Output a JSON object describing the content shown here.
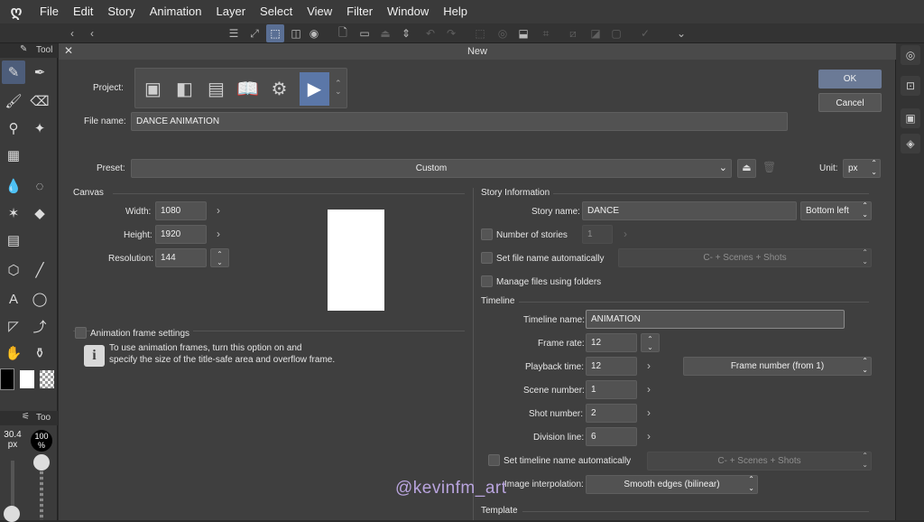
{
  "menubar": {
    "logo": "ღ",
    "items": [
      "File",
      "Edit",
      "Story",
      "Animation",
      "Layer",
      "Select",
      "View",
      "Filter",
      "Window",
      "Help"
    ]
  },
  "command_bar": {
    "icons": [
      "menu-icon",
      "resize-icon",
      "transform-icon",
      "color-profile-icon",
      "new-file-icon",
      "open-file-icon",
      "save-icon",
      "scroll-icon",
      "undo-icon",
      "redo-icon",
      "select-icon",
      "fill-icon",
      "clear-icon",
      "crop-icon",
      "deselect-icon",
      "invert-icon",
      "border-icon",
      "check-icon",
      "chevron-down-icon"
    ]
  },
  "left_panel": {
    "tool_header": "Tool",
    "sub_tool_header": "Too",
    "brush_size": "30.4",
    "brush_unit": "px",
    "opacity": "100",
    "opacity_unit": "%"
  },
  "dialog": {
    "title": "New",
    "project_label": "Project:",
    "file_name_label": "File name:",
    "file_name_value": "DANCE ANIMATION",
    "preset_label": "Preset:",
    "preset_value": "Custom",
    "unit_label": "Unit:",
    "unit_value": "px",
    "ok_label": "OK",
    "cancel_label": "Cancel",
    "canvas": {
      "section": "Canvas",
      "width_label": "Width:",
      "width_value": "1080",
      "height_label": "Height:",
      "height_value": "1920",
      "resolution_label": "Resolution:",
      "resolution_value": "144"
    },
    "animation_frame": {
      "label": "Animation frame settings",
      "info_line1": "To use animation frames, turn this option on and",
      "info_line2": "specify the size of the title-safe area and overflow frame."
    },
    "story": {
      "section": "Story Information",
      "story_name_label": "Story name:",
      "story_name_value": "DANCE",
      "position_value": "Bottom left",
      "number_of_stories_label": "Number of stories",
      "number_of_stories_value": "1",
      "set_file_name_label": "Set file name automatically",
      "file_name_pattern": "C- + Scenes + Shots",
      "manage_files_label": "Manage files using folders"
    },
    "timeline": {
      "section": "Timeline",
      "timeline_name_label": "Timeline name:",
      "timeline_name_value": "ANIMATION",
      "frame_rate_label": "Frame rate:",
      "frame_rate_value": "12",
      "playback_time_label": "Playback time:",
      "playback_time_value": "12",
      "playback_unit": "Frame number (from 1)",
      "scene_number_label": "Scene number:",
      "scene_number_value": "1",
      "shot_number_label": "Shot number:",
      "shot_number_value": "2",
      "division_line_label": "Division line:",
      "division_line_value": "6",
      "set_timeline_name_label": "Set timeline name automatically",
      "timeline_name_pattern": "C- + Scenes + Shots",
      "image_interpolation_label": "Image interpolation:",
      "image_interpolation_value": "Smooth edges (bilinear)"
    },
    "template_section": "Template"
  },
  "watermark": "@kevinfm_art",
  "colors": {
    "accent": "#5b77a8",
    "ok_button": "#6b7a96",
    "watermark": "#b9a4de"
  }
}
